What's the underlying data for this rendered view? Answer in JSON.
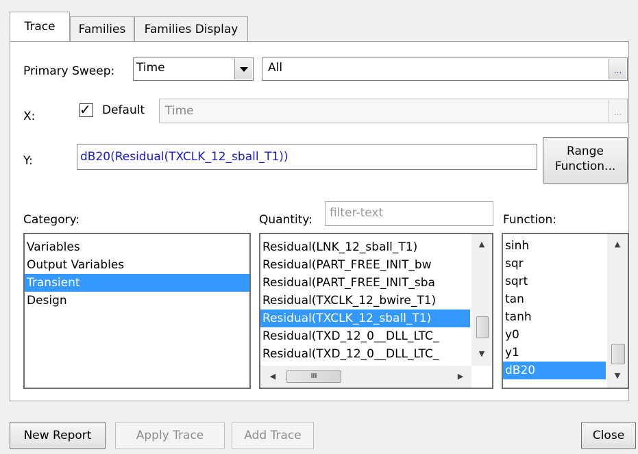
{
  "tabs": [
    {
      "label": "Trace"
    },
    {
      "label": "Families"
    },
    {
      "label": "Families Display"
    }
  ],
  "primary_sweep": {
    "label": "Primary Sweep:",
    "value": "Time",
    "range": "All",
    "ellipsis": "..."
  },
  "x": {
    "label": "X:",
    "default_label": "Default",
    "default_checked": true,
    "value": "Time",
    "ellipsis": "..."
  },
  "y": {
    "label": "Y:",
    "value": "dB20(Residual(TXCLK_12_sball_T1))",
    "range_button_line1": "Range",
    "range_button_line2": "Function..."
  },
  "category": {
    "label": "Category:",
    "items": [
      "Variables",
      "Output Variables",
      "Transient",
      "Design"
    ],
    "selected": "Transient"
  },
  "quantity": {
    "label": "Quantity:",
    "filter_placeholder": "filter-text",
    "items": [
      "Residual(LNK_12_sball_T1)",
      "Residual(PART_FREE_INIT_bw",
      "Residual(PART_FREE_INIT_sba",
      "Residual(TXCLK_12_bwire_T1)",
      "Residual(TXCLK_12_sball_T1)",
      "Residual(TXD_12_0__DLL_LTC_",
      "Residual(TXD_12_0__DLL_LTC_"
    ],
    "selected_index": 4,
    "hscroll_grip": "III"
  },
  "function": {
    "label": "Function:",
    "items": [
      "sinh",
      "sqr",
      "sqrt",
      "tan",
      "tanh",
      "y0",
      "y1",
      "dB20"
    ],
    "selected_index": 7
  },
  "buttons": {
    "new_report": "New Report",
    "apply_trace": "Apply Trace",
    "add_trace": "Add Trace",
    "close": "Close"
  },
  "colors": {
    "selection": "#3399ff",
    "y_expression_text": "#1a1acc",
    "panel_bg": "#ffffff",
    "window_bg": "#f0f0f0"
  }
}
